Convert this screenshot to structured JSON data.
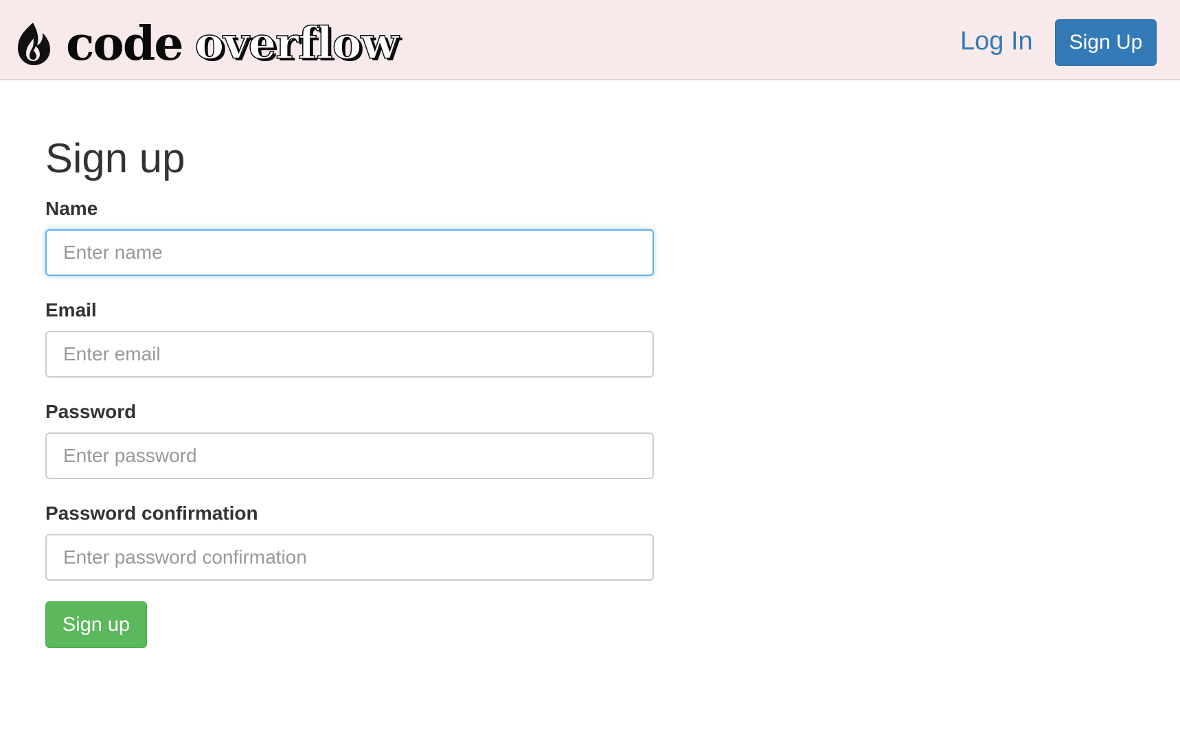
{
  "header": {
    "logo_icon": "flame-icon",
    "brand_word1": "code",
    "brand_word2": "overflow",
    "login_link": "Log In",
    "signup_button": "Sign Up"
  },
  "form": {
    "title": "Sign up",
    "fields": [
      {
        "label": "Name",
        "placeholder": "Enter name",
        "value": "",
        "focused": true
      },
      {
        "label": "Email",
        "placeholder": "Enter email",
        "value": ""
      },
      {
        "label": "Password",
        "placeholder": "Enter password",
        "value": ""
      },
      {
        "label": "Password confirmation",
        "placeholder": "Enter password confirmation",
        "value": ""
      }
    ],
    "submit_label": "Sign up"
  },
  "colors": {
    "header_bg": "#f8eaea",
    "link": "#337ab7",
    "primary_button": "#337ab7",
    "success_button": "#5cb85c",
    "focus_border": "#66afe9"
  }
}
